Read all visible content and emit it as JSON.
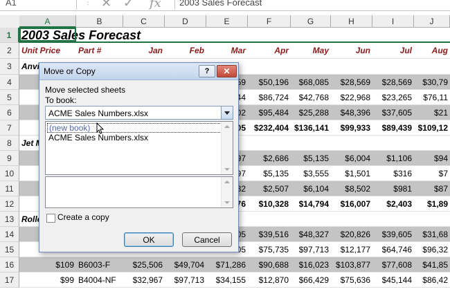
{
  "formula_bar": {
    "name_box": "A1",
    "content": "2003 Sales Forecast",
    "cancel_glyph": "✕",
    "enter_glyph": "✓",
    "fx_glyph": "fx"
  },
  "columns": [
    "A",
    "B",
    "C",
    "D",
    "E",
    "F",
    "G",
    "H",
    "I",
    "J"
  ],
  "rows": [
    {
      "n": "1",
      "cells": {
        "A": "2003 Sales Forecast"
      },
      "style": "title"
    },
    {
      "n": "2",
      "cells": {
        "A": "Unit Price",
        "B": "Part #",
        "C": "Jan",
        "D": "Feb",
        "E": "Mar",
        "F": "Apr",
        "G": "May",
        "H": "Jun",
        "I": "Jul",
        "J": "Aug"
      },
      "style": "hdr"
    },
    {
      "n": "3",
      "cells": {
        "A": "Anvi"
      },
      "style": "group"
    },
    {
      "n": "4",
      "cells": {
        "E": "59",
        "F": "$50,196",
        "G": "$68,085",
        "H": "$28,569",
        "I": "$28,569",
        "J": "$30,79"
      },
      "style": "gray"
    },
    {
      "n": "5",
      "cells": {
        "E": "44",
        "F": "$86,724",
        "G": "$42,768",
        "H": "$22,968",
        "I": "$23,265",
        "J": "$76,11"
      },
      "style": ""
    },
    {
      "n": "6",
      "cells": {
        "E": "02",
        "F": "$95,484",
        "G": "$25,288",
        "H": "$48,396",
        "I": "$37,605",
        "J": "$21"
      },
      "style": "gray"
    },
    {
      "n": "7",
      "cells": {
        "E": "05",
        "F": "$232,404",
        "G": "$136,141",
        "H": "$99,933",
        "I": "$89,439",
        "J": "$109,12"
      },
      "style": "tot"
    },
    {
      "n": "8",
      "cells": {
        "A": "Jet M"
      },
      "style": "group"
    },
    {
      "n": "9",
      "cells": {
        "E": "97",
        "F": "$2,686",
        "G": "$5,135",
        "H": "$6,004",
        "I": "$1,106",
        "J": "$94"
      },
      "style": "gray"
    },
    {
      "n": "10",
      "cells": {
        "E": "97",
        "F": "$5,135",
        "G": "$3,555",
        "H": "$1,501",
        "I": "$316",
        "J": "$7"
      },
      "style": ""
    },
    {
      "n": "11",
      "cells": {
        "E": "82",
        "F": "$2,507",
        "G": "$6,104",
        "H": "$8,502",
        "I": "$981",
        "J": "$87"
      },
      "style": "gray"
    },
    {
      "n": "12",
      "cells": {
        "E": "76",
        "F": "$10,328",
        "G": "$14,794",
        "H": "$16,007",
        "I": "$2,403",
        "J": "$1,89"
      },
      "style": "tot"
    },
    {
      "n": "13",
      "cells": {
        "A": "Rolle"
      },
      "style": "group"
    },
    {
      "n": "14",
      "cells": {
        "E": "05",
        "F": "$39,516",
        "G": "$48,327",
        "H": "$20,826",
        "I": "$39,605",
        "J": "$31,68"
      },
      "style": "gray"
    },
    {
      "n": "15",
      "cells": {
        "E": "05",
        "F": "$75,735",
        "G": "$97,713",
        "H": "$12,177",
        "I": "$64,746",
        "J": "$96,32"
      },
      "style": ""
    },
    {
      "n": "16",
      "cells": {
        "A": "$109",
        "B": "B6003-F",
        "C": "$25,506",
        "D": "$49,704",
        "E": "$71,286",
        "F": "$90,688",
        "G": "$16,023",
        "H": "$103,877",
        "I": "$77,608",
        "J": "$41,85"
      },
      "style": "gray"
    },
    {
      "n": "17",
      "cells": {
        "A": "$99",
        "B": "B4004-NF",
        "C": "$32,967",
        "D": "$97,713",
        "E": "$34,155",
        "F": "$12,870",
        "G": "$66,429",
        "H": "$75,636",
        "I": "$45,144",
        "J": "$86,42"
      },
      "style": ""
    }
  ],
  "dialog": {
    "title": "Move or Copy",
    "help_label": "?",
    "close_label": "✕",
    "move_label": "Move selected sheets",
    "to_book_label": "To book:",
    "combo_value": "ACME Sales Numbers.xlsx",
    "book_items": [
      "(new book)",
      "ACME Sales Numbers.xlsx"
    ],
    "create_copy_label": "Create a copy",
    "ok_label": "OK",
    "cancel_label": "Cancel"
  }
}
